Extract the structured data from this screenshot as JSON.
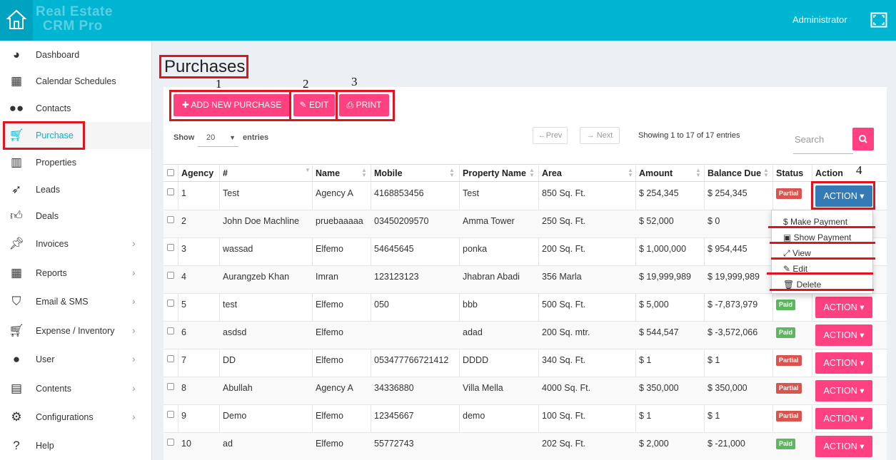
{
  "app": {
    "brand_line1": "Real Estate",
    "brand_line2": "CRM Pro",
    "user": "Administrator"
  },
  "colors": {
    "header": "#00b5d2",
    "accent": "#ff4081",
    "primary": "#337ab7",
    "annotation": "#e0141e"
  },
  "sidebar": {
    "items": [
      {
        "label": "Dashboard",
        "icon": "dashboard-icon"
      },
      {
        "label": "Calendar Schedules",
        "icon": "calendar-icon"
      },
      {
        "label": "Contacts",
        "icon": "users-icon"
      },
      {
        "label": "Purchase",
        "icon": "cart-icon"
      },
      {
        "label": "Properties",
        "icon": "building-icon"
      },
      {
        "label": "Leads",
        "icon": "rocket-icon"
      },
      {
        "label": "Deals",
        "icon": "thumbs-up-icon"
      },
      {
        "label": "Invoices",
        "icon": "pin-icon"
      },
      {
        "label": "Reports",
        "icon": "table-icon"
      },
      {
        "label": "Email & SMS",
        "icon": "shield-icon"
      },
      {
        "label": "Expense / Inventory",
        "icon": "cart-icon"
      },
      {
        "label": "User",
        "icon": "user-icon"
      },
      {
        "label": "Contents",
        "icon": "newspaper-icon"
      },
      {
        "label": "Configurations",
        "icon": "gears-icon"
      },
      {
        "label": "Help",
        "icon": "question-icon"
      }
    ]
  },
  "page": {
    "title": "Purchases",
    "add_label": "ADD NEW PURCHASE",
    "edit_label": "EDIT",
    "print_label": "PRINT",
    "annotations": [
      "1",
      "2",
      "3",
      "4"
    ],
    "show_label": "Show",
    "entries_label": "entries",
    "page_size": "20",
    "prev_label": "←Prev",
    "next_label": "→ Next",
    "showing": "Showing 1 to 17 of 17 entries",
    "search_placeholder": "Search"
  },
  "table": {
    "columns": [
      "Agency",
      "#",
      "Name",
      "Mobile",
      "Property Name",
      "Area",
      "Amount",
      "Balance Due",
      "Status",
      "Action"
    ],
    "action_label": "ACTION",
    "rows": [
      {
        "agency": "1",
        "num": "Test",
        "name": "Agency A",
        "mobile": "4168853456",
        "property": "Test",
        "area": "850 Sq. Ft.",
        "amount": "$ 254,345",
        "balance": "$ 254,345",
        "status": "Partial"
      },
      {
        "agency": "2",
        "num": "John Doe Machline",
        "name": "pruebaaaaa",
        "mobile": "03450209570",
        "property": "Amma Tower",
        "area": "250 Sq. Ft.",
        "amount": "$ 52,000",
        "balance": "$ 0",
        "status": ""
      },
      {
        "agency": "3",
        "num": "wassad",
        "name": "Elfemo",
        "mobile": "54645645",
        "property": "ponka",
        "area": "200 Sq. Ft.",
        "amount": "$ 1,000,000",
        "balance": "$ 954,445",
        "status": ""
      },
      {
        "agency": "4",
        "num": "Aurangzeb Khan",
        "name": "Imran",
        "mobile": "123123123",
        "property": "Jhabran Abadi",
        "area": "356 Marla",
        "amount": "$ 19,999,989",
        "balance": "$ 19,999,989",
        "status": ""
      },
      {
        "agency": "5",
        "num": "test",
        "name": "Elfemo",
        "mobile": "050",
        "property": "bbb",
        "area": "500 Sq. Ft.",
        "amount": "$ 5,000",
        "balance": "$ -7,873,979",
        "status": "Paid"
      },
      {
        "agency": "6",
        "num": "asdsd",
        "name": "Elfemo",
        "mobile": "",
        "property": "adad",
        "area": "200 Sq. mtr.",
        "amount": "$ 544,547",
        "balance": "$ -3,572,066",
        "status": "Paid"
      },
      {
        "agency": "7",
        "num": "DD",
        "name": "Elfemo",
        "mobile": "053477766721412",
        "property": "DDDD",
        "area": "340 Sq. Ft.",
        "amount": "$ 1",
        "balance": "$ 1",
        "status": "Partial"
      },
      {
        "agency": "8",
        "num": "Abullah",
        "name": "Agency A",
        "mobile": "34336880",
        "property": "Villa Mella",
        "area": "4000 Sq. Ft.",
        "amount": "$ 350,000",
        "balance": "$ 350,000",
        "status": "Partial"
      },
      {
        "agency": "9",
        "num": "Demo",
        "name": "Elfemo",
        "mobile": "12345667",
        "property": "demo",
        "area": "100 Sq. Ft.",
        "amount": "$ 1",
        "balance": "$ 1",
        "status": "Partial"
      },
      {
        "agency": "10",
        "num": "ad",
        "name": "Elfemo",
        "mobile": "55772743",
        "property": "",
        "area": "202 Sq. Ft.",
        "amount": "$ 2,000",
        "balance": "$ -21,000",
        "status": "Paid"
      }
    ]
  },
  "dropdown": {
    "items": [
      "$ Make Payment",
      "Show Payment",
      "View",
      "Edit",
      "Delete"
    ]
  }
}
